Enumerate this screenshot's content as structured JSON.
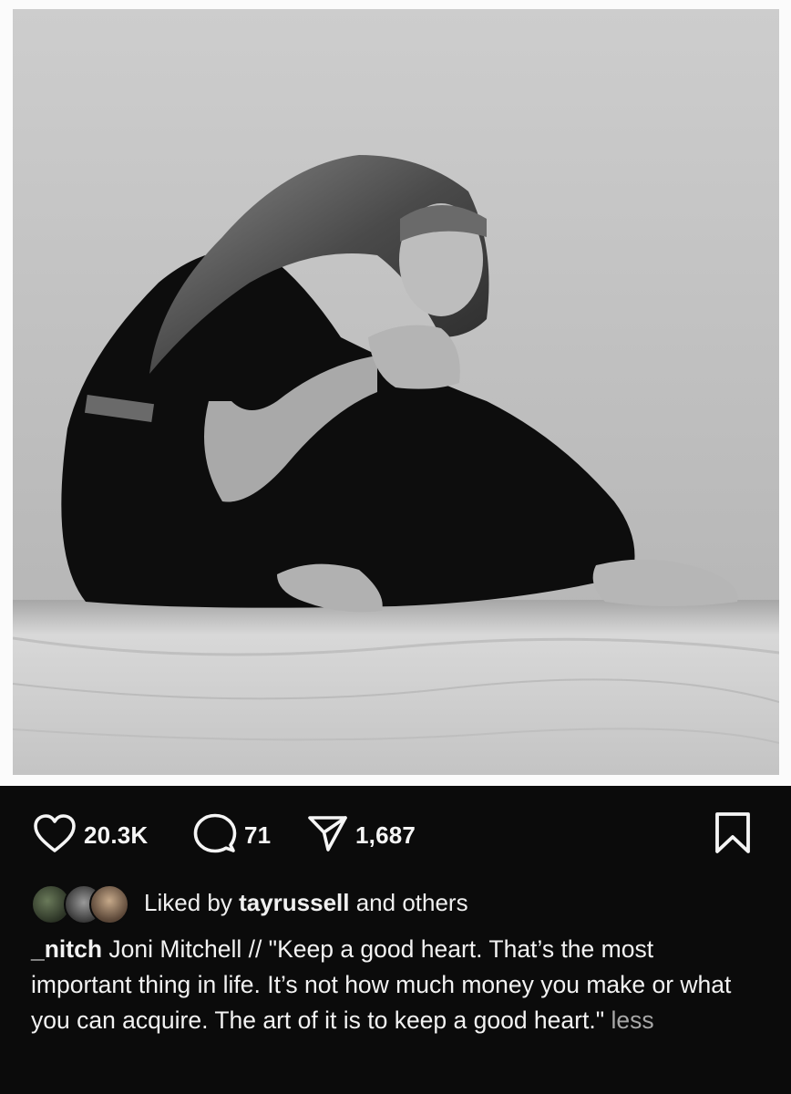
{
  "post": {
    "image_alt": "Black and white portrait photo"
  },
  "actions": {
    "likes": "20.3K",
    "comments": "71",
    "shares": "1,687"
  },
  "liked_by": {
    "prefix": "Liked by",
    "user": "tayrussell",
    "suffix": "and others"
  },
  "caption": {
    "username": "_nitch",
    "text": "Joni Mitchell // \"Keep a good heart. That’s the most important thing in life. It’s not how much money you make or what you can acquire. The art of it is to keep a good heart.\"",
    "less_label": "less"
  },
  "colors": {
    "panel_bg": "#0b0b0b",
    "text": "#f5f5f5",
    "muted": "#a8a8a8"
  }
}
